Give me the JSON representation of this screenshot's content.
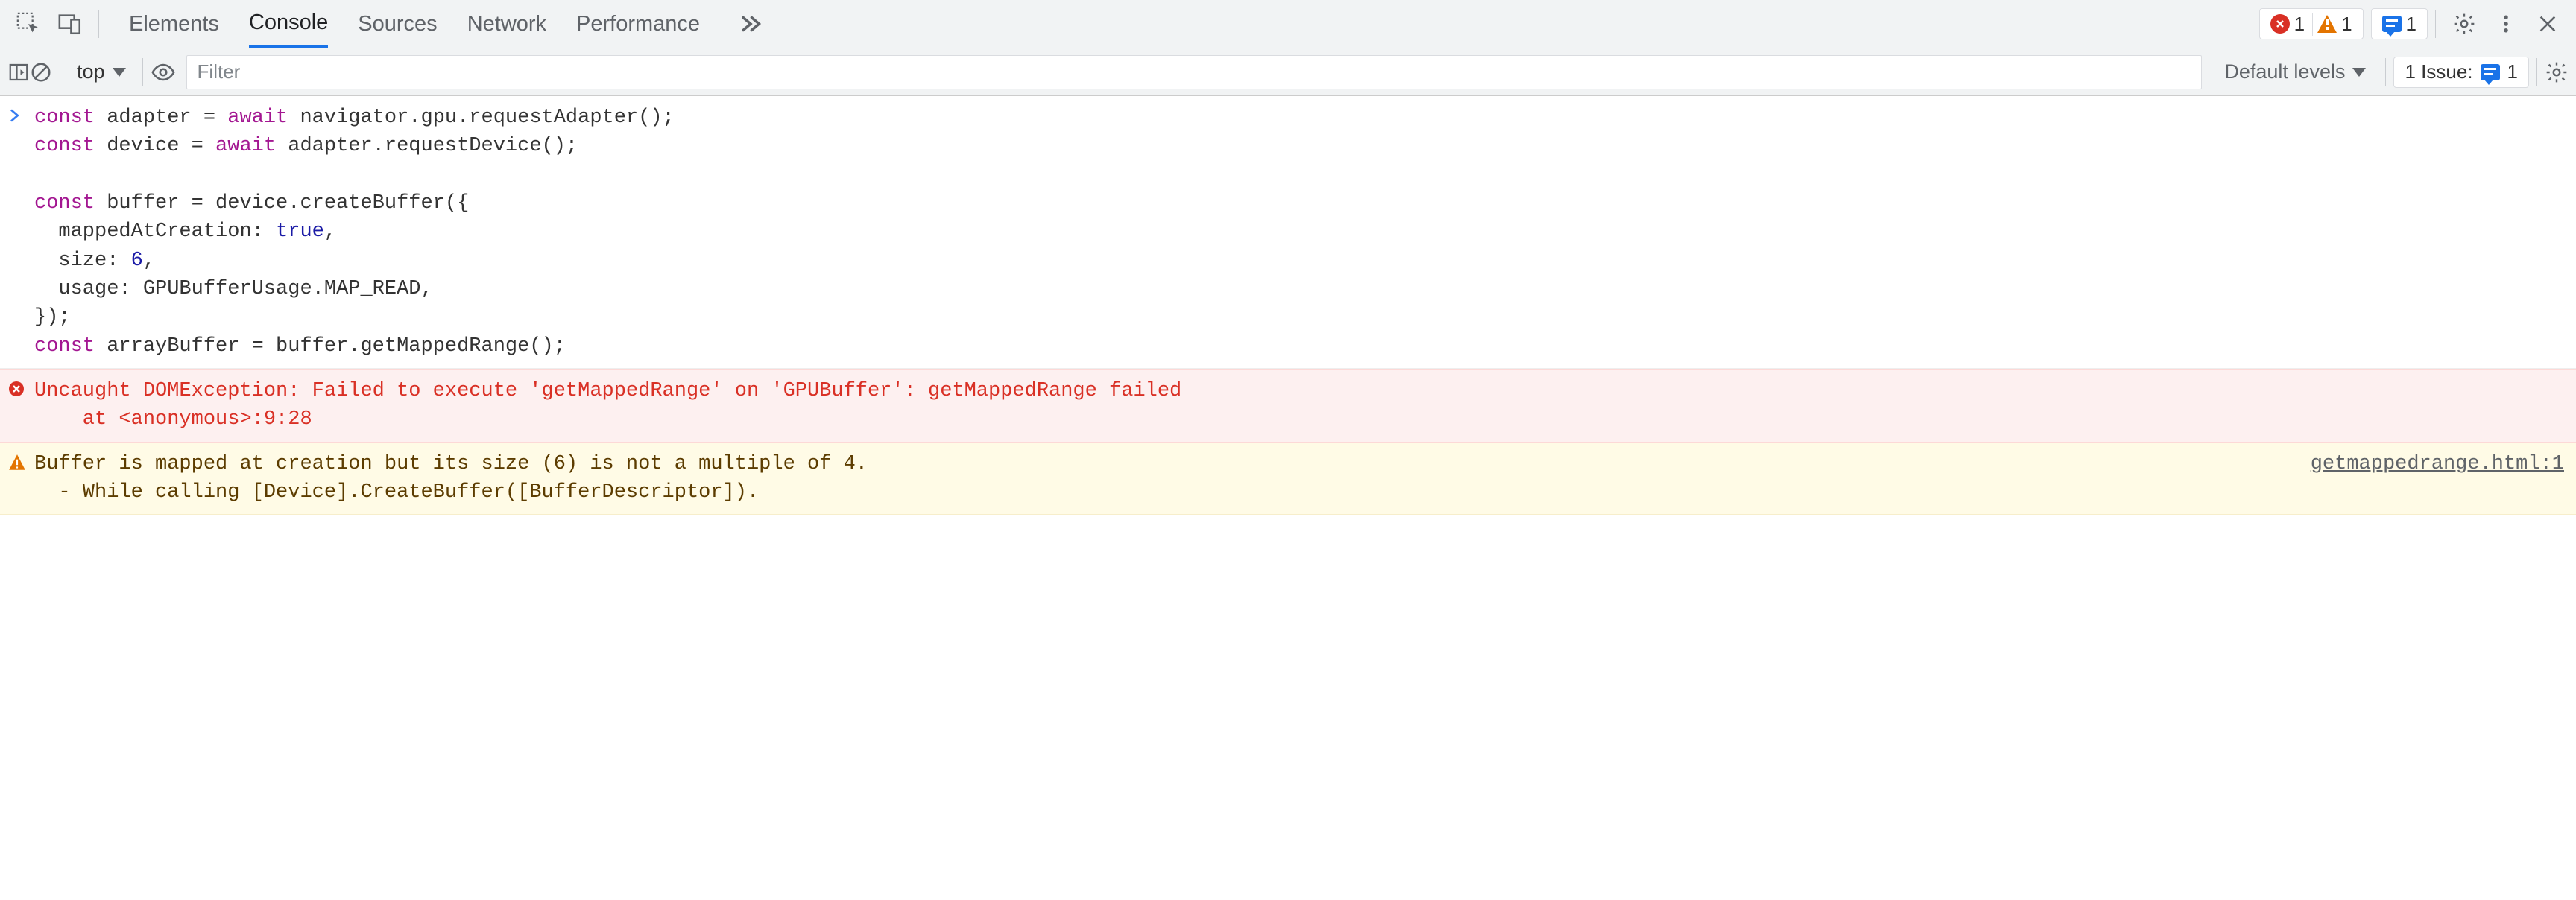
{
  "tabs": {
    "elements": "Elements",
    "console": "Console",
    "sources": "Sources",
    "network": "Network",
    "performance": "Performance"
  },
  "counts": {
    "errors": "1",
    "warnings": "1",
    "info": "1"
  },
  "subbar": {
    "context": "top",
    "filter_placeholder": "Filter",
    "levels": "Default levels",
    "issues_label": "1 Issue:",
    "issues_count": "1"
  },
  "input": {
    "code_html": "<span class=\"kw\">const</span> adapter = <span class=\"kw\">await</span> navigator.gpu.requestAdapter();\n<span class=\"kw\">const</span> device = <span class=\"kw\">await</span> adapter.requestDevice();\n\n<span class=\"kw\">const</span> buffer = device.createBuffer({\n  mappedAtCreation: <span class=\"lit\">true</span>,\n  size: <span class=\"lit\">6</span>,\n  usage: GPUBufferUsage.MAP_READ,\n});\n<span class=\"kw\">const</span> arrayBuffer = buffer.getMappedRange();"
  },
  "error": {
    "text": "Uncaught DOMException: Failed to execute 'getMappedRange' on 'GPUBuffer': getMappedRange failed\n    at <anonymous>:9:28"
  },
  "warning": {
    "line1": "Buffer is mapped at creation but its size (6) is not a multiple of 4.",
    "line2": "  - While calling [Device].CreateBuffer([BufferDescriptor]).",
    "source": "getmappedrange.html:1"
  }
}
